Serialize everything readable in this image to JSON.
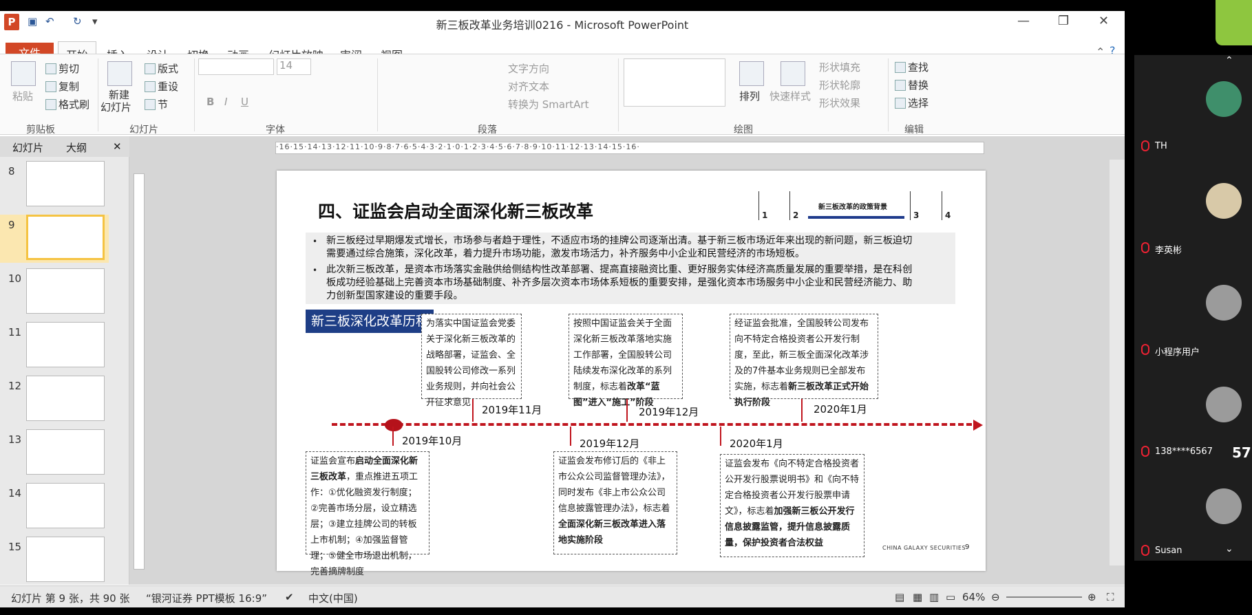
{
  "window": {
    "title": "新三板改革业务培训0216 - Microsoft PowerPoint"
  },
  "tabs": [
    "文件",
    "开始",
    "插入",
    "设计",
    "切换",
    "动画",
    "幻灯片放映",
    "审阅",
    "视图"
  ],
  "ribbon": {
    "clipboard": {
      "paste": "粘贴",
      "cut": "剪切",
      "copy": "复制",
      "format_painter": "格式刷",
      "group": "剪贴板"
    },
    "slides": {
      "new_slide": "新建",
      "new_slide2": "幻灯片",
      "layout": "版式",
      "reset": "重设",
      "section": "节",
      "group": "幻灯片"
    },
    "font": {
      "size": "14",
      "group": "字体"
    },
    "paragraph": {
      "text_direction": "文字方向",
      "align_text": "对齐文本",
      "smartart": "转换为 SmartArt",
      "group": "段落"
    },
    "drawing": {
      "arrange": "排列",
      "quick_styles": "快速样式",
      "fill": "形状填充",
      "outline": "形状轮廓",
      "effects": "形状效果",
      "group": "绘图"
    },
    "editing": {
      "find": "查找",
      "replace": "替换",
      "select": "选择",
      "group": "编辑"
    }
  },
  "slide_panel": {
    "tab_slides": "幻灯片",
    "tab_outline": "大纲",
    "thumbs": [
      "8",
      "9",
      "10",
      "11",
      "12",
      "13",
      "14",
      "15"
    ]
  },
  "ruler": "·16·15·14·13·12·11·10·9·8·7·6·5·4·3·2·1·0·1·2·3·4·5·6·7·8·9·10·11·12·13·14·15·16·",
  "slide": {
    "title": "四、证监会启动全面深化新三板改革",
    "toc": {
      "nums": [
        "1",
        "2",
        "3",
        "4"
      ],
      "label": "新三板改革的政策背景"
    },
    "bullet1_l1": "新三板经过早期爆发式增长，市场参与者趋于理性，不适应市场的挂牌公司逐渐出清。基于新三板市场近年来出现的新问题，新三板迫切",
    "bullet1_l2": "需要通过综合施策，深化改革，着力提升市场功能，激发市场活力，补齐服务中小企业和民营经济的市场短板。",
    "bullet2_l1": "此次新三板改革，是资本市场落实金融供给侧结构性改革部署、提高直接融资比重、更好服务实体经济高质量发展的重要举措，是在科创",
    "bullet2_l2": "板成功经验基础上完善资本市场基础制度、补齐多层次资本市场体系短板的重要安排，是强化资本市场服务中小企业和民营经济能力、助",
    "bullet2_l3": "力创新型国家建设的重要手段。",
    "history": "新三板深化改革历程",
    "box1": "为落实中国证监会党委关于深化新三板改革的战略部署，证监会、全国股转公司修改一系列业务规则，并向社会公开征求意见",
    "box2a": "按照中国证监会关于全面深化新三板改革落地实施工作部署，全国股转公司陆续发布深化改革的系列制度，标志着",
    "box2b": "改革“蓝图”进入“施工”阶段",
    "box3a": "经证监会批准，全国股转公司发布向不特定合格投资者公开发行制度，至此，新三板全面深化改革涉及的7件基本业务规则已全部发布实施，标志着",
    "box3b": "新三板改革正式开始执行阶段",
    "box4a": "证监会宣布",
    "box4b": "启动全面深化新三板改革",
    "box4c": "，重点推进五项工作：①优化融资发行制度；②完善市场分层，设立精选层；③建立挂牌公司的转板上市机制；④加强监督管理；⑤健全市场退出机制，完善摘牌制度",
    "box5a": "证监会发布修订后的《非上市公众公司监督管理办法》，同时发布《非上市公众公司信息披露管理办法》，标志着",
    "box5b": "全面深化新三板改革进入落地实施阶段",
    "box6a": "证监会发布《向不特定合格投资者公开发行股票说明书》和《向不特定合格投资者公开发行股票申请文》，标志着",
    "box6b": "加强新三板公开发行信息披露监管，提升信息披露质量，保护投资者合法权益",
    "dates": [
      "2019年11月",
      "2019年12月",
      "2020年1月",
      "2019年10月",
      "2019年12月",
      "2020年1月"
    ],
    "footer_logo": "CHINA GALAXY SECURITIES",
    "page": "9"
  },
  "status": {
    "slide_info": "幻灯片 第 9 张，共 90 张",
    "theme": "“银河证券 PPT模板 16:9”",
    "lang": "中文(中国)",
    "zoom": "64%"
  },
  "meeting": {
    "participants": [
      "TH",
      "李英彬",
      "小程序用户",
      "138****6567",
      "Susan"
    ],
    "badge": "57"
  }
}
